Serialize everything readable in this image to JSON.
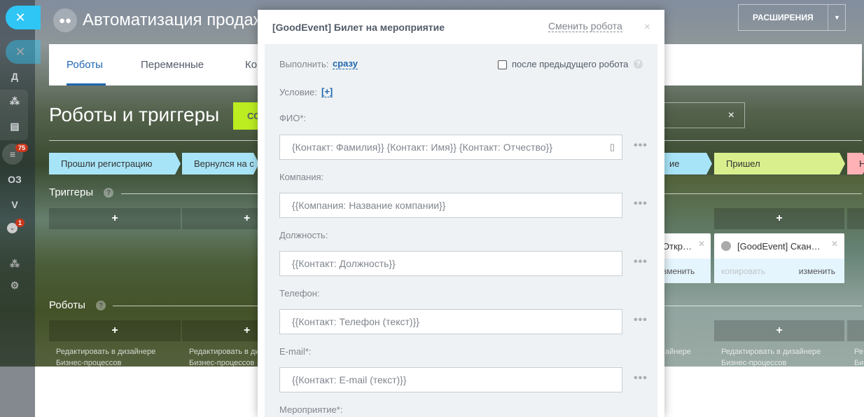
{
  "header": {
    "title": "Автоматизация продаж",
    "extensions_button": "РАСШИРЕНИЯ"
  },
  "sidebar": {
    "letters": [
      "Д",
      "ОЗ",
      "V"
    ],
    "badges": [
      "75",
      "1"
    ]
  },
  "tabs": [
    {
      "label": "Роботы",
      "active": true
    },
    {
      "label": "Переменные"
    },
    {
      "label": "Ко"
    }
  ],
  "page": {
    "heading": "Роботы и триггеры",
    "green_button": "СО",
    "search_clear": "×"
  },
  "stages": [
    {
      "label": "Прошли регистрацию",
      "color": "#a8e4f7"
    },
    {
      "label": "Вернулся на с",
      "color": "#a8e4f7"
    },
    {
      "label": "ие",
      "color": "#a8e4f7"
    },
    {
      "label": "Пришел",
      "color": "#d9ef8e"
    },
    {
      "label": "Н",
      "color": "#ffb1b5"
    }
  ],
  "triggers": {
    "title": "Триггеры",
    "help": "?"
  },
  "cards": [
    {
      "title": "Откр…",
      "copy": "",
      "edit": "изменить"
    },
    {
      "title": "[GoodEvent] Скан…",
      "copy": "копировать",
      "edit": "изменить"
    }
  ],
  "robots": {
    "title": "Роботы",
    "help": "?",
    "edit_link_line1": "Редактировать в дизайнере",
    "edit_link_line2": "Бизнес-процессов",
    "partial_line1": "Ре",
    "partial_line2": "Би",
    "partial_mid": "айнере"
  },
  "modal": {
    "title": "[GoodEvent] Билет на мероприятие",
    "change_robot": "Сменить робота",
    "close": "×",
    "execute_label": "Выполнить:",
    "execute_value": "сразу",
    "after_previous": "после предыдущего робота",
    "condition_label": "Условие:",
    "condition_value": "[+]",
    "fields": [
      {
        "label": "ФИО*:",
        "value": "{Контакт: Фамилия}} {Контакт: Имя}} {Контакт: Отчество}}"
      },
      {
        "label": "Компания:",
        "value": "{{Компания: Название компании}}"
      },
      {
        "label": "Должность:",
        "value": "{{Контакт: Должность}}"
      },
      {
        "label": "Телефон:",
        "value": "{{Контакт: Телефон (текст)}}"
      },
      {
        "label": "E-mail*:",
        "value": "{{Контакт: E-mail (текст)}}"
      }
    ],
    "last_label": "Мероприятие*:"
  }
}
